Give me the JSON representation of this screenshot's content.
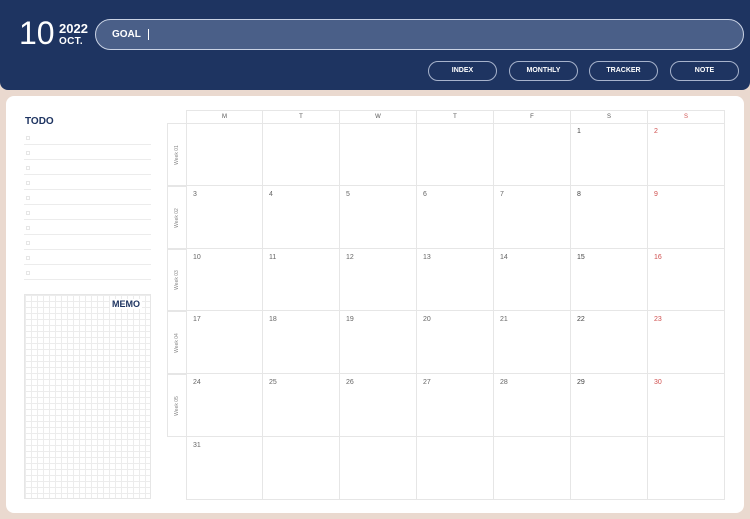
{
  "header": {
    "month_number": "10",
    "year": "2022",
    "month_abbr": "OCT.",
    "goal_label": "GOAL",
    "nav": [
      "INDEX",
      "MONTHLY",
      "TRACKER",
      "NOTE"
    ]
  },
  "sidebar": {
    "todo_title": "TODO",
    "memo_title": "MEMO"
  },
  "calendar": {
    "days": [
      "M",
      "T",
      "W",
      "T",
      "F",
      "S",
      "S"
    ],
    "weeks": [
      "Week 01",
      "Week 02",
      "Week 03",
      "Week 04",
      "Week 05"
    ],
    "rows": [
      [
        "",
        "",
        "",
        "",
        "",
        "1",
        "2"
      ],
      [
        "3",
        "4",
        "5",
        "6",
        "7",
        "8",
        "9"
      ],
      [
        "10",
        "11",
        "12",
        "13",
        "14",
        "15",
        "16"
      ],
      [
        "17",
        "18",
        "19",
        "20",
        "21",
        "22",
        "23"
      ],
      [
        "24",
        "25",
        "26",
        "27",
        "28",
        "29",
        "30"
      ],
      [
        "31",
        "",
        "",
        "",
        "",
        "",
        ""
      ]
    ]
  },
  "colors": {
    "navy": "#1e3461",
    "sunday_red": "#d0504f",
    "background": "#ead9cf"
  }
}
